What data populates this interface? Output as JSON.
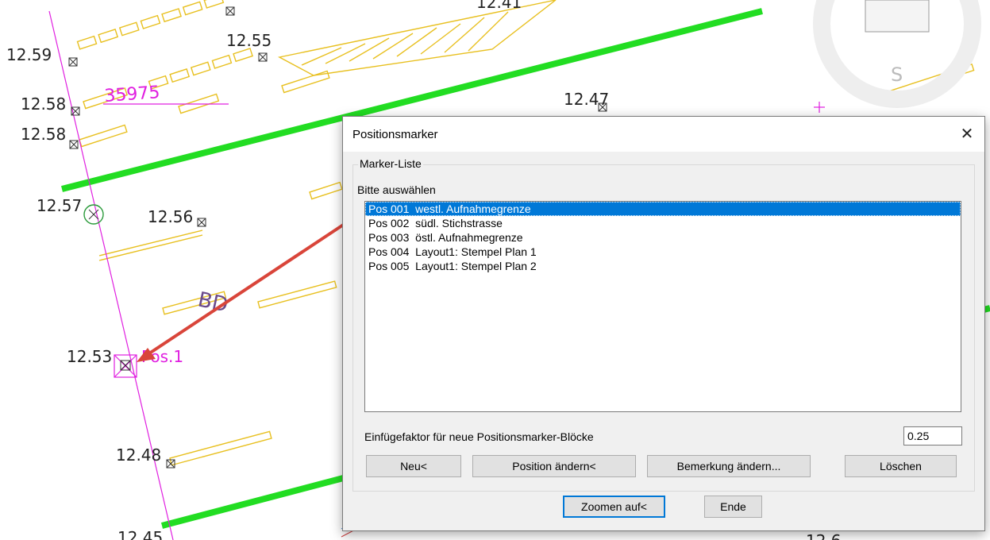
{
  "drawing": {
    "elevations": [
      "12.59",
      "12.55",
      "12.58",
      "12.58",
      "12.57",
      "12.56",
      "12.47",
      "12.53",
      "12.48",
      "12.45"
    ],
    "parcel_number": "35975",
    "area_code": "BD",
    "marker_label": "Pos.1",
    "compass_letter": "S",
    "partial_labels": [
      "12.41",
      "12.6"
    ]
  },
  "dialog": {
    "title": "Positionsmarker",
    "close_glyph": "✕",
    "group_title": "Marker-Liste",
    "list_caption": "Bitte auswählen",
    "items": [
      "Pos 001  westl. Aufnahmegrenze",
      "Pos 002  südl. Stichstrasse",
      "Pos 003  östl. Aufnahmegrenze",
      "Pos 004  Layout1: Stempel Plan 1",
      "Pos 005  Layout1: Stempel Plan 2"
    ],
    "selected_index": 0,
    "factor_label": "Einfügefaktor für neue Positionsmarker-Blöcke",
    "factor_value": "0.25",
    "buttons": {
      "new": "Neu<",
      "change_position": "Position ändern<",
      "change_remark": "Bemerkung ändern...",
      "delete": "Löschen",
      "zoom": "Zoomen auf<",
      "end": "Ende"
    }
  },
  "colors": {
    "line_green": "#22dd22",
    "hatch_yellow": "#e8c020",
    "annotation_magenta": "#e020e0",
    "arrow_red": "#d9453a",
    "selection_blue": "#0078d7"
  }
}
